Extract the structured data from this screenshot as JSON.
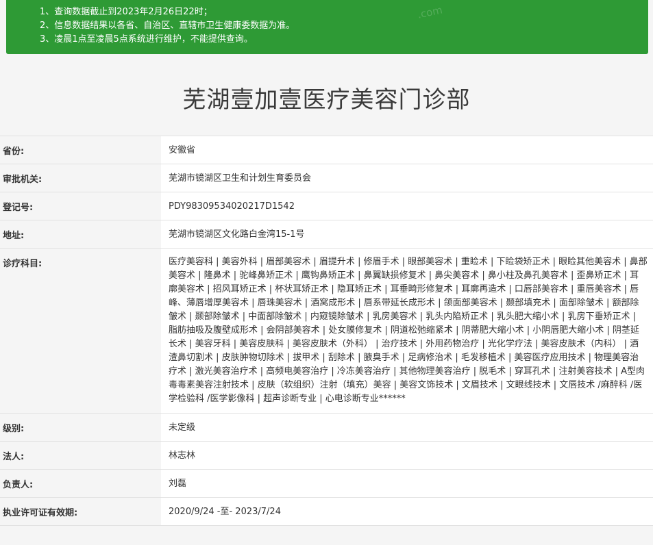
{
  "notice": {
    "lines": [
      "1、查询数据截止到2023年2月26日22时；",
      "2、信息数据结果以各省、自治区、直辖市卫生健康委数据为准。",
      "3、凌晨1点至凌晨5点系统进行维护，不能提供查询。"
    ]
  },
  "title": "芜湖壹加壹医疗美容门诊部",
  "fields": [
    {
      "label": "省份:",
      "value": "安徽省"
    },
    {
      "label": "审批机关:",
      "value": "芜湖市镜湖区卫生和计划生育委员会"
    },
    {
      "label": "登记号:",
      "value": "PDY98309534020217D1542"
    },
    {
      "label": "地址:",
      "value": "芜湖市镜湖区文化路白金湾15-1号"
    },
    {
      "label": "诊疗科目:",
      "value": "医疗美容科 | 美容外科 | 眉部美容术 | 眉提升术 | 修眉手术 | 眼部美容术 | 重睑术 | 下睑袋矫正术 | 眼睑其他美容术 | 鼻部美容术 | 隆鼻术 | 驼峰鼻矫正术 | 鹰钩鼻矫正术 | 鼻翼缺损修复术 | 鼻尖美容术 | 鼻小柱及鼻孔美容术 | 歪鼻矫正术 | 耳廓美容术 | 招风耳矫正术 | 杯状耳矫正术 | 隐耳矫正术 | 耳垂畸形修复术 | 耳廓再造术 | 口唇部美容术 | 重唇美容术 | 唇峰、薄唇增厚美容术 | 唇珠美容术 | 酒窝成形术 | 唇系带延长成形术 | 颌面部美容术 | 颞部填充术 | 面部除皱术 | 额部除皱术 | 颞部除皱术 | 中面部除皱术 | 内窥镜除皱术 | 乳房美容术 | 乳头内陷矫正术 | 乳头肥大缩小术 | 乳房下垂矫正术 | 脂肪抽吸及腹壁成形术 | 会阴部美容术 | 处女膜修复术 | 阴道松弛缩紧术 | 阴蒂肥大缩小术 | 小阴唇肥大缩小术 | 阴茎延长术 | 美容牙科 | 美容皮肤科 | 美容皮肤术（外科） | 治疗技术 | 外用药物治疗 | 光化学疗法 | 美容皮肤术（内科） | 酒渣鼻切割术 | 皮肤肿物切除术 | 拔甲术 | 刮除术 | 腋臭手术 | 足病修治术 | 毛发移植术 | 美容医疗应用技术 | 物理美容治疗术 | 激光美容治疗术 | 高频电美容治疗 | 冷冻美容治疗 | 其他物理美容治疗 | 脱毛术 | 穿耳孔术 | 注射美容技术 | A型肉毒毒素美容注射技术 | 皮肤（软组织）注射（填充）美容 | 美容文饰技术 | 文眉技术 | 文眼线技术 | 文唇技术 /麻醉科 /医学检验科 /医学影像科 | 超声诊断专业 | 心电诊断专业******"
    },
    {
      "label": "级别:",
      "value": "未定级"
    },
    {
      "label": "法人:",
      "value": "林志林"
    },
    {
      "label": "负责人:",
      "value": "刘磊"
    },
    {
      "label": "执业许可证有效期:",
      "value": "2020/9/24 -至- 2023/7/24"
    }
  ]
}
